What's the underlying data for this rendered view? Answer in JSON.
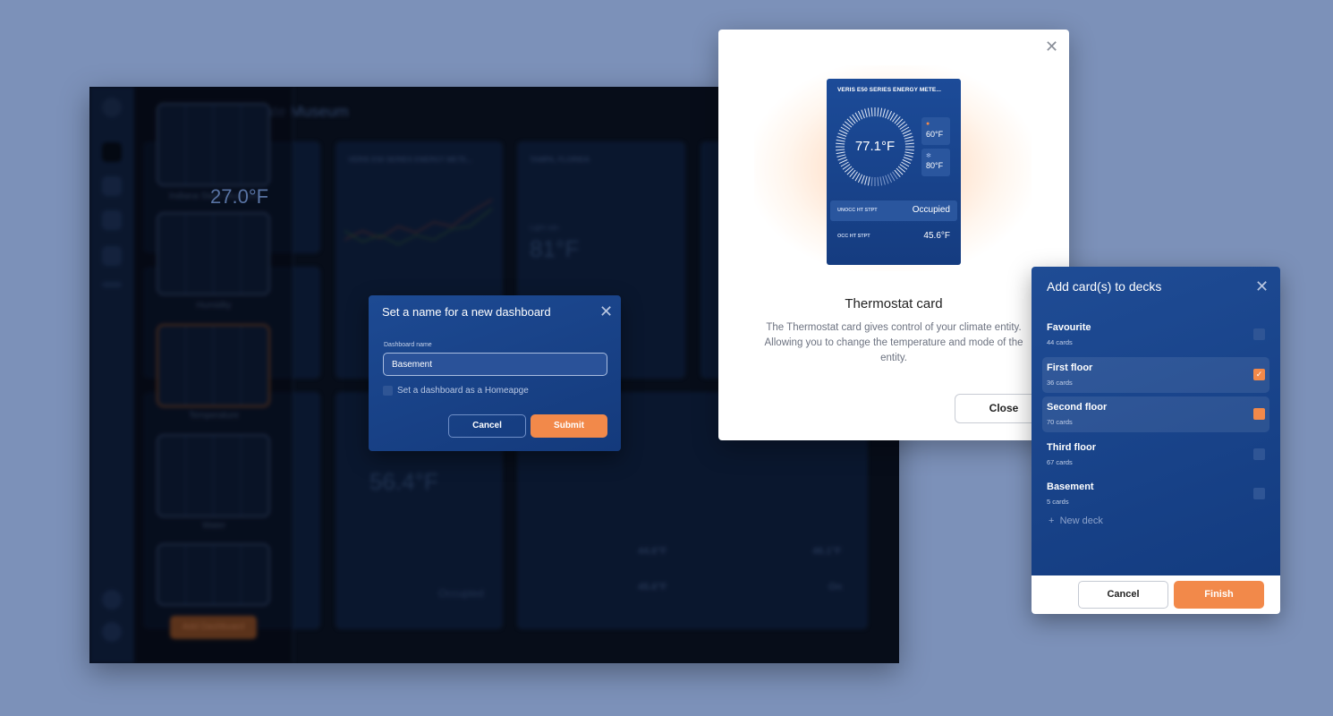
{
  "background_app": {
    "title": "State Museum",
    "decks": [
      "Indiana State Museum",
      "Humidity",
      "Temperature",
      "Water"
    ],
    "add_dashboard_label": "Add Dashboard",
    "cards": {
      "energy_meter_title": "VERIS E50 SERIES ENERGY METE...",
      "weather_location": "TAMPA, FLORIDA",
      "weather_condition": "Light rain",
      "weather_temp": "81°F",
      "thermostat_temp": "56.4°F",
      "thermostat_status": "Occupied",
      "switch_status": "On",
      "value_1": "44.6°F",
      "value_2": "45.6°F",
      "value_3": "46.1°F",
      "value_4": "27.0°F"
    }
  },
  "name_dialog": {
    "title": "Set a name for a new dashboard",
    "field_label": "Dashboard name",
    "field_value": "Basement",
    "homepage_checkbox_label": "Set a dashboard as a Homeapge",
    "homepage_checked": false,
    "cancel_label": "Cancel",
    "submit_label": "Submit"
  },
  "thermostat_modal": {
    "preview": {
      "header": "VERIS E50 SERIES ENERGY METE...",
      "current_temp": "77.1°F",
      "heat_setpoint": "60°F",
      "cool_setpoint": "80°F",
      "rows": [
        {
          "label": "UNOCC HT STPT",
          "value": "Occupied"
        },
        {
          "label": "OCC HT STPT",
          "value": "45.6°F"
        }
      ]
    },
    "title": "Thermostat card",
    "description": "The Thermostat card gives control of your climate entity. Allowing you to change the temperature and mode of the entity.",
    "close_label": "Close"
  },
  "decks_dialog": {
    "title": "Add card(s) to decks",
    "decks": [
      {
        "name": "Favourite",
        "count": "44 cards",
        "checked": false
      },
      {
        "name": "First floor",
        "count": "36 cards",
        "checked": true
      },
      {
        "name": "Second floor",
        "count": "70 cards",
        "checked": true
      },
      {
        "name": "Third floor",
        "count": "67 cards",
        "checked": false
      },
      {
        "name": "Basement",
        "count": "5 cards",
        "checked": false
      }
    ],
    "new_deck_label": "New deck",
    "cancel_label": "Cancel",
    "finish_label": "Finish"
  },
  "colors": {
    "accent": "#f2894a",
    "primary": "#1c4b98",
    "page_bg": "#7c91b9"
  }
}
